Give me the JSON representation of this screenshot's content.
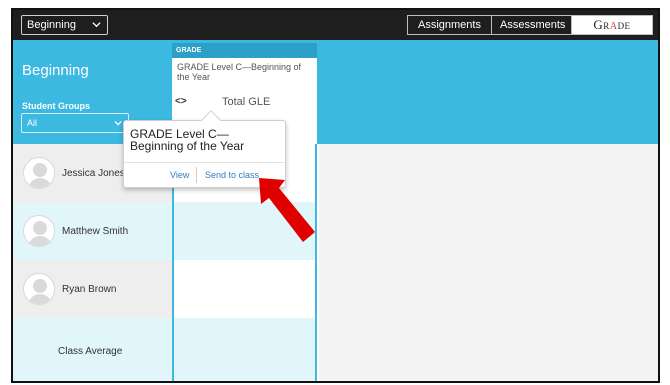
{
  "topbar": {
    "level_select": "Beginning",
    "tabs": [
      "Assignments",
      "Assessments"
    ],
    "brand": {
      "pre": "Gr",
      "accent": "A",
      "post": "de"
    }
  },
  "header": {
    "title": "Beginning",
    "groups_label": "Student Groups",
    "groups_value": "All"
  },
  "grade": {
    "tag": "GRADE",
    "name": "GRADE Level C—Beginning of the Year",
    "code_icon": "<>",
    "total_label": "Total GLE"
  },
  "students": [
    {
      "name": "Jessica Jones"
    },
    {
      "name": "Matthew Smith"
    },
    {
      "name": "Ryan Brown"
    }
  ],
  "class_average_label": "Class Average",
  "popover": {
    "title": "GRADE Level C— Beginning of the Year",
    "view_label": "View",
    "send_label": "Send to class"
  },
  "colors": {
    "band": "#3cb9e0",
    "topbar": "#1e1e1e",
    "link": "#2d7fc1",
    "annotation_arrow": "#e00000"
  }
}
